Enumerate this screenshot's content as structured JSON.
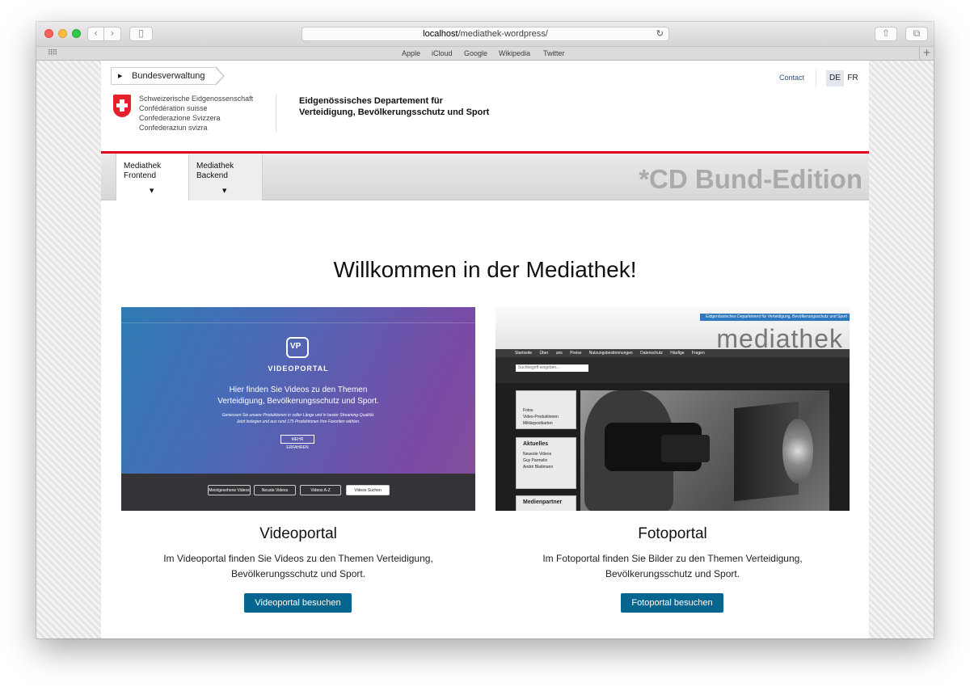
{
  "browser": {
    "url_host": "localhost",
    "url_path": "/mediathek-wordpress/",
    "favorites": [
      "Apple",
      "iCloud",
      "Google",
      "Wikipedia",
      "Twitter"
    ]
  },
  "header": {
    "breadcrumb": "Bundesverwaltung",
    "confederation": [
      "Schweizerische Eidgenossenschaft",
      "Confédération suisse",
      "Confederazione Svizzera",
      "Confederaziun svizra"
    ],
    "department": [
      "Eidgenössisches Departement für",
      "Verteidigung, Bevölkerungsschutz und Sport"
    ],
    "contact": "Contact",
    "languages": [
      "DE",
      "FR"
    ],
    "active_language": "DE"
  },
  "nav": {
    "tabs": [
      {
        "line1": "Mediathek",
        "line2": "Frontend",
        "active": true
      },
      {
        "line1": "Mediathek",
        "line2": "Backend",
        "active": false
      }
    ],
    "edition": "*CD Bund-Edition"
  },
  "main": {
    "welcome": "Willkommen in der Mediathek!",
    "columns": [
      {
        "title": "Videoportal",
        "text1": "Im Videoportal finden Sie Videos zu den Themen Verteidigung,",
        "text2": "Bevölkerungsschutz und Sport.",
        "button": "Videoportal besuchen",
        "preview": {
          "brand": "VIDEOPORTAL",
          "headline1": "Hier finden Sie Videos zu den Themen",
          "headline2": "Verteidigung, Bevölkerungsschutz und Sport.",
          "subtext1": "Geniessen Sie unsere Produktionen in voller Länge und in bester Streaming-Qualität.",
          "subtext2": "Jetzt loslegen und aus rund 175 Produktionen Ihre Favoriten wählen.",
          "more": "MEHR ERFAHREN",
          "buttons": [
            "Meistgesehene Videos",
            "Neuste Videos",
            "Videos A-Z",
            "Videos Suchen"
          ]
        }
      },
      {
        "title": "Fotoportal",
        "text1": "Im Fotoportal finden Sie Bilder zu den Themen Verteidigung,",
        "text2": "Bevölkerungsschutz und Sport.",
        "button": "Fotoportal besuchen",
        "preview": {
          "banner": "Eidgenössisches Departement für Verteidigung, Bevölkerungsschutz und Sport",
          "title": "mediathek",
          "nav": [
            "Startseite",
            "Über uns",
            "Preise",
            "Nutzungsbestimmungen",
            "Datenschutz",
            "Häufige Fragen"
          ],
          "search_placeholder": "Suchbegriff eingeben...",
          "sidebar_box1": [
            "Fotos",
            "Video-Produktionen",
            "Militärpostkarten"
          ],
          "sidebar_box2_title": "Aktuelles",
          "sidebar_box2": [
            "Neueste Videos",
            "Guy Parmelin",
            "André Blattmann"
          ],
          "sidebar_box3_title": "Medienpartner"
        }
      }
    ]
  }
}
